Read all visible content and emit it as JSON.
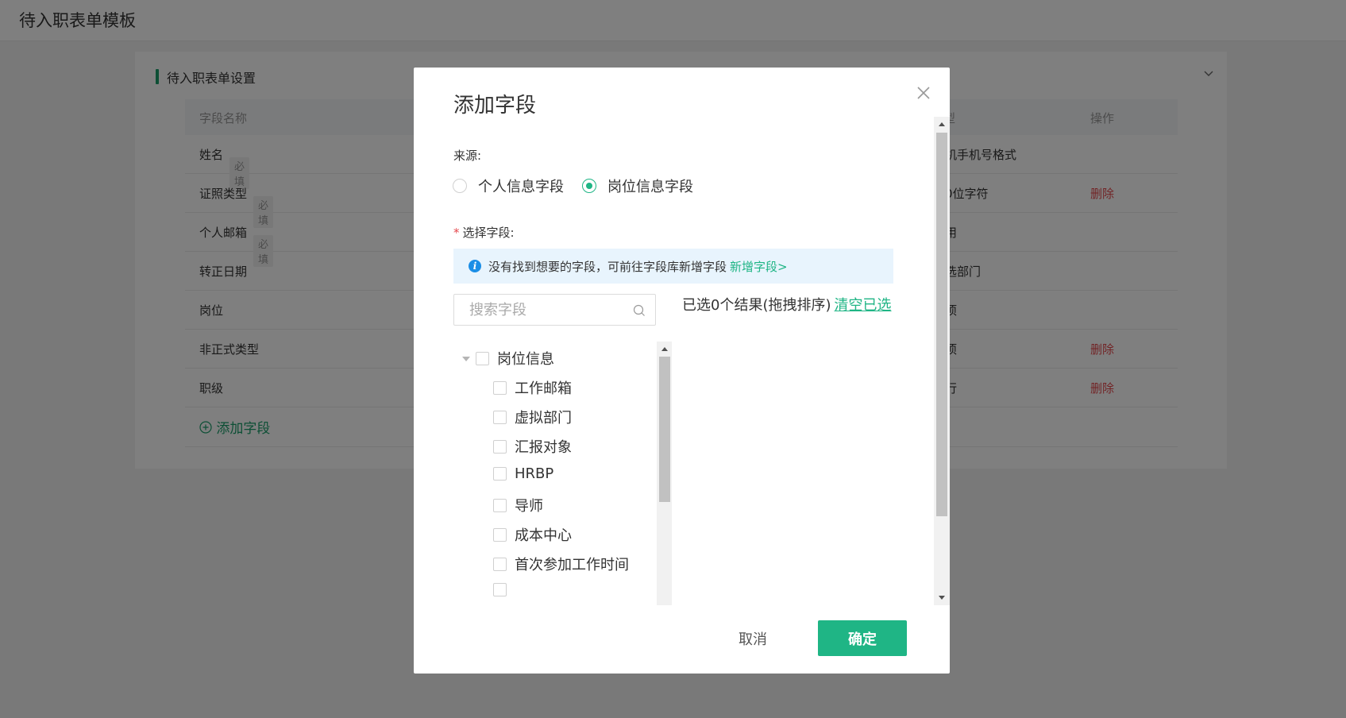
{
  "page": {
    "title": "待入职表单模板",
    "section_title": "待入职表单设置",
    "table": {
      "col_name": "字段名称",
      "col_rule_partial": "型",
      "col_action": "操作",
      "required_badge": "必填",
      "delete_label": "删除",
      "rows": [
        {
          "name": "姓名",
          "required": true,
          "rule": "机手机号格式",
          "deletable": false
        },
        {
          "name": "证照类型",
          "required": true,
          "rule": "0位字符",
          "deletable": true
        },
        {
          "name": "个人邮箱",
          "required": true,
          "rule": "用",
          "deletable": false
        },
        {
          "name": "转正日期",
          "required": false,
          "rule": "选部门",
          "deletable": false
        },
        {
          "name": "岗位",
          "required": false,
          "rule": "项",
          "deletable": false
        },
        {
          "name": "非正式类型",
          "required": false,
          "rule": "项",
          "deletable": true
        },
        {
          "name": "职级",
          "required": false,
          "rule": "行",
          "deletable": true
        }
      ],
      "add_field_label": "添加字段"
    }
  },
  "modal": {
    "title": "添加字段",
    "source_label": "来源:",
    "source_options": [
      {
        "label": "个人信息字段",
        "checked": false
      },
      {
        "label": "岗位信息字段",
        "checked": true
      }
    ],
    "select_label": "选择字段:",
    "notice_text": "没有找到想要的字段，可前往字段库新增字段",
    "notice_link": "新增字段>",
    "search_placeholder": "搜索字段",
    "tree": {
      "group_label": "岗位信息",
      "items": [
        "工作邮箱",
        "虚拟部门",
        "汇报对象",
        "HRBP",
        "导师",
        "成本中心",
        "首次参加工作时间"
      ]
    },
    "selected_summary": "已选0个结果(拖拽排序)",
    "clear_label": "清空已选",
    "cancel_label": "取消",
    "confirm_label": "确定"
  },
  "colors": {
    "accent": "#1fb585",
    "danger": "#e5484d",
    "info": "#1b8ee6"
  }
}
